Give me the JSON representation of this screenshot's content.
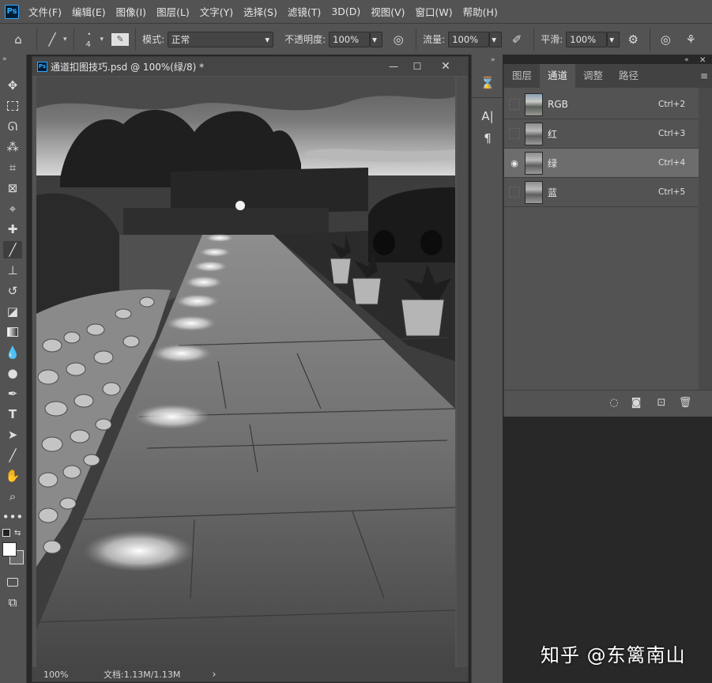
{
  "app": {
    "logo_text": "Ps"
  },
  "menu": [
    "文件(F)",
    "编辑(E)",
    "图像(I)",
    "图层(L)",
    "文字(Y)",
    "选择(S)",
    "滤镜(T)",
    "3D(D)",
    "视图(V)",
    "窗口(W)",
    "帮助(H)"
  ],
  "options": {
    "brush_size": "4",
    "mode_label": "模式:",
    "mode_value": "正常",
    "opacity_label": "不透明度:",
    "opacity_value": "100%",
    "flow_label": "流量:",
    "flow_value": "100%",
    "smooth_label": "平滑:",
    "smooth_value": "100%"
  },
  "document": {
    "title": "通道扣图技巧.psd @ 100%(绿/8) *",
    "zoom": "100%",
    "file_info": "文档:1.13M/1.13M",
    "status_arrow": "›"
  },
  "channels_panel": {
    "tabs": [
      "图层",
      "通道",
      "调整",
      "路径"
    ],
    "active_tab": "通道",
    "channels": [
      {
        "name": "RGB",
        "shortcut": "Ctrl+2",
        "visible": false,
        "selected": false
      },
      {
        "name": "红",
        "shortcut": "Ctrl+3",
        "visible": false,
        "selected": false
      },
      {
        "name": "绿",
        "shortcut": "Ctrl+4",
        "visible": true,
        "selected": true
      },
      {
        "name": "蓝",
        "shortcut": "Ctrl+5",
        "visible": false,
        "selected": false
      }
    ]
  },
  "watermark": "知乎 @东篱南山",
  "colors": {
    "ui_bg": "#535353",
    "workspace_bg": "#282828",
    "selected_row": "#6d6d6d",
    "accent": "#31a8ff"
  }
}
